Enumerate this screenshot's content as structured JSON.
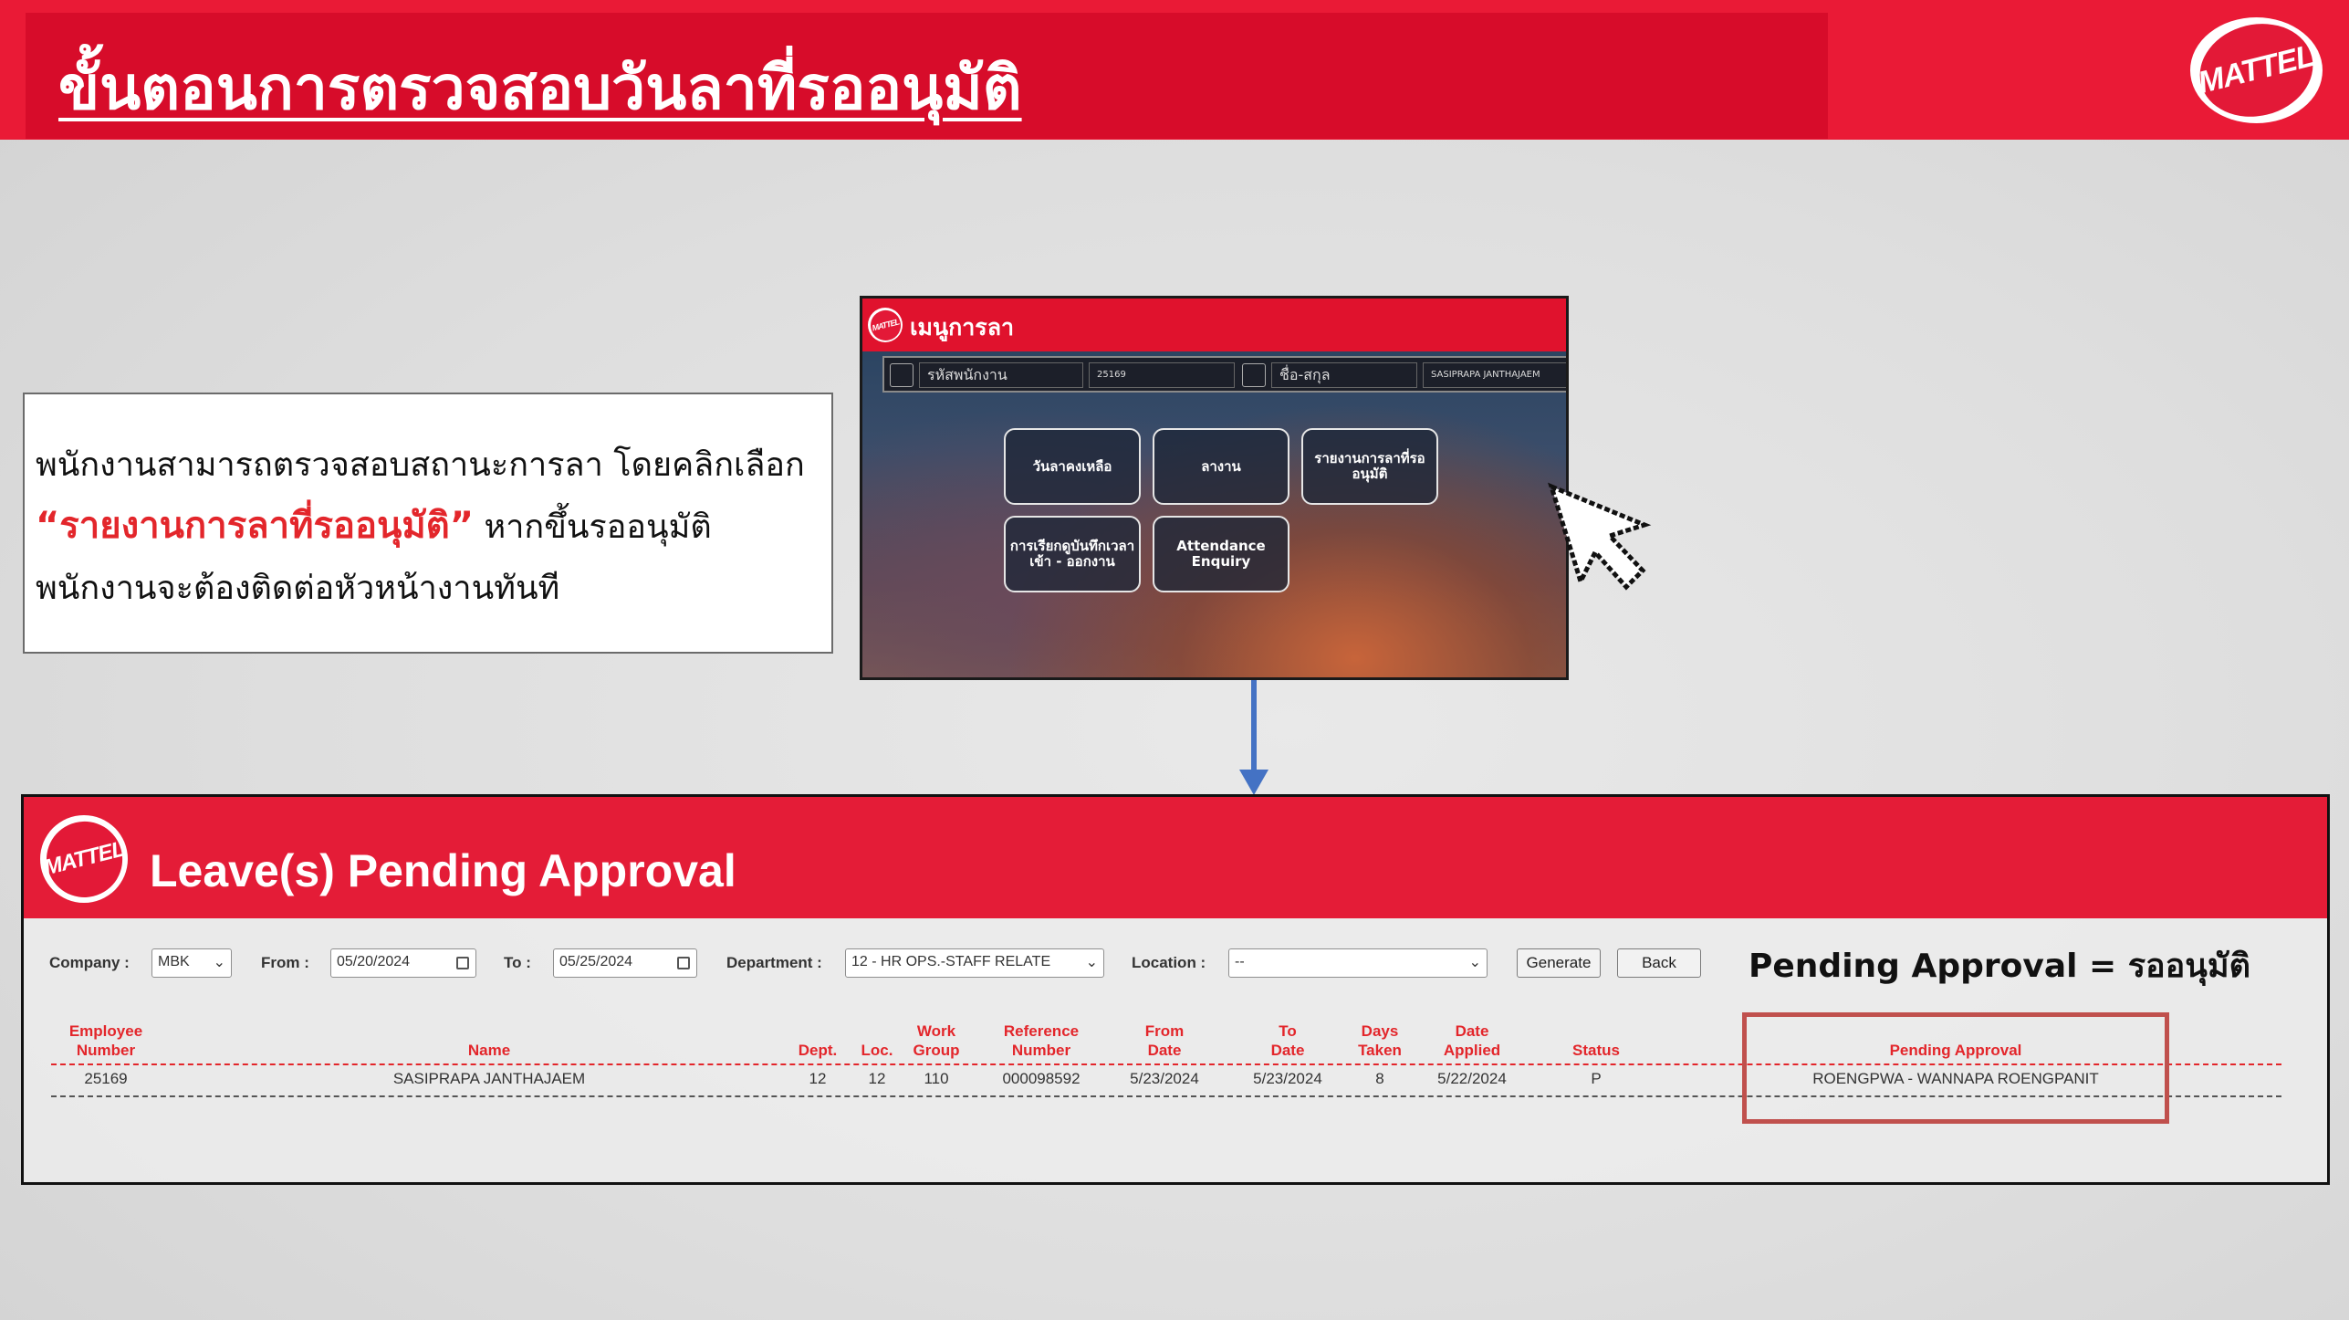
{
  "slide": {
    "title": "ขั้นตอนการตรวจสอบวันลาที่รออนุมัติ",
    "brand_logo": "MATTEL",
    "colors": {
      "brand_red": "#e41c37",
      "highlight_red": "#e3262b",
      "box_border": "#c0504d",
      "arrow_blue": "#4472c4"
    }
  },
  "instructions": {
    "line1": "พนักงานสามารถตรวจสอบสถานะการลา โดยคลิกเลือก",
    "highlight": "“รายงานการลาที่รออนุมัติ”",
    "line2_rest": " หากขึ้นรออนุมัติ",
    "line3": "พนักงานจะต้องติดต่อหัวหน้างานทันที"
  },
  "menu_screen": {
    "title": "เมนูการลา",
    "logo": "MATTEL",
    "employee_id_label": "รหัสพนักงาน",
    "employee_id": "25169",
    "name_label": "ชื่อ-สกุล",
    "name": "SASIPRAPA JANTHAJAEM",
    "buttons": [
      {
        "label": "วันลาคงเหลือ"
      },
      {
        "label": "ลางาน"
      },
      {
        "label": "รายงานการลาที่รออนุมัติ"
      },
      {
        "label": "การเรียกดูบันทึกเวลาเข้า - ออกงาน"
      },
      {
        "label": "Attendance Enquiry"
      }
    ],
    "icons": [
      "id-card-icon",
      "user-icon",
      "pointer-cursor-icon"
    ]
  },
  "pending_panel": {
    "title": "Leave(s) Pending Approval",
    "logo": "MATTEL",
    "filters": {
      "company_label": "Company :",
      "company_value": "MBK",
      "from_label": "From :",
      "from_value": "05/20/2024",
      "to_label": "To :",
      "to_value": "05/25/2024",
      "department_label": "Department :",
      "department_value": "12 - HR OPS.-STAFF RELATE",
      "location_label": "Location :",
      "location_value": "--",
      "generate_label": "Generate",
      "back_label": "Back"
    },
    "note": "Pending Approval = รออนุมัติ",
    "columns": [
      {
        "line1": "Employee",
        "line2": "Number"
      },
      {
        "line1": "",
        "line2": "Name"
      },
      {
        "line1": "",
        "line2": "Dept."
      },
      {
        "line1": "",
        "line2": "Loc."
      },
      {
        "line1": "Work",
        "line2": "Group"
      },
      {
        "line1": "Reference",
        "line2": "Number"
      },
      {
        "line1": "From",
        "line2": "Date"
      },
      {
        "line1": "To",
        "line2": "Date"
      },
      {
        "line1": "Days",
        "line2": "Taken"
      },
      {
        "line1": "Date",
        "line2": "Applied"
      },
      {
        "line1": "",
        "line2": "Status"
      },
      {
        "line1": "",
        "line2": "Pending Approval"
      }
    ],
    "rows": [
      [
        "25169",
        "SASIPRAPA JANTHAJAEM",
        "12",
        "12",
        "110",
        "000098592",
        "5/23/2024",
        "5/23/2024",
        "8",
        "5/22/2024",
        "P",
        "ROENGPWA - WANNAPA ROENGPANIT"
      ]
    ]
  }
}
